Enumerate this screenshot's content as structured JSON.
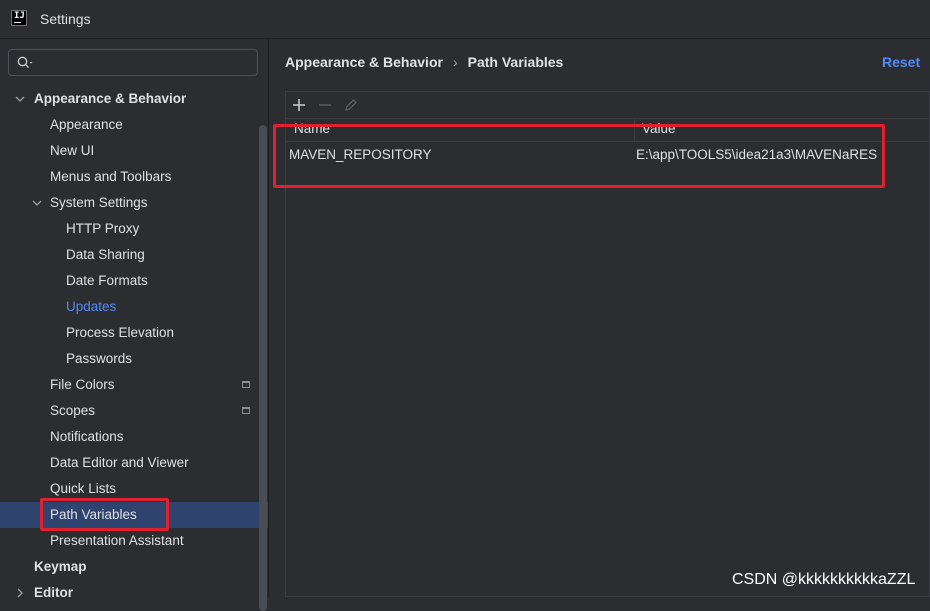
{
  "window": {
    "title": "Settings"
  },
  "search": {
    "value": ""
  },
  "sidebar": {
    "items": [
      {
        "label": "Appearance & Behavior",
        "level": 0,
        "expanded": true,
        "bold": true
      },
      {
        "label": "Appearance",
        "level": 1
      },
      {
        "label": "New UI",
        "level": 1
      },
      {
        "label": "Menus and Toolbars",
        "level": 1
      },
      {
        "label": "System Settings",
        "level": 1,
        "expanded": true
      },
      {
        "label": "HTTP Proxy",
        "level": 2
      },
      {
        "label": "Data Sharing",
        "level": 2
      },
      {
        "label": "Date Formats",
        "level": 2
      },
      {
        "label": "Updates",
        "level": 2,
        "link": true
      },
      {
        "label": "Process Elevation",
        "level": 2
      },
      {
        "label": "Passwords",
        "level": 2
      },
      {
        "label": "File Colors",
        "level": 1,
        "project_icon": true
      },
      {
        "label": "Scopes",
        "level": 1,
        "project_icon": true
      },
      {
        "label": "Notifications",
        "level": 1
      },
      {
        "label": "Data Editor and Viewer",
        "level": 1
      },
      {
        "label": "Quick Lists",
        "level": 1
      },
      {
        "label": "Path Variables",
        "level": 1,
        "selected": true
      },
      {
        "label": "Presentation Assistant",
        "level": 1
      },
      {
        "label": "Keymap",
        "level": 0,
        "bold": true
      },
      {
        "label": "Editor",
        "level": 0,
        "bold": true,
        "collapsed": true
      }
    ]
  },
  "breadcrumb": {
    "parent": "Appearance & Behavior",
    "separator": "›",
    "current": "Path Variables"
  },
  "reset_label": "Reset",
  "toolbar": {
    "add_icon": "plus-icon",
    "remove_icon": "minus-icon",
    "edit_icon": "pencil-icon"
  },
  "table": {
    "columns": [
      "Name",
      "Value"
    ],
    "rows": [
      {
        "name": "MAVEN_REPOSITORY",
        "value": "E:\\app\\TOOLS5\\idea21a3\\MAVENaRES"
      }
    ]
  },
  "watermark": "CSDN @kkkkkkkkkkaZZL",
  "colors": {
    "background": "#2b2d30",
    "selection": "#2e436e",
    "link": "#548af7",
    "highlight": "#e0202e"
  }
}
